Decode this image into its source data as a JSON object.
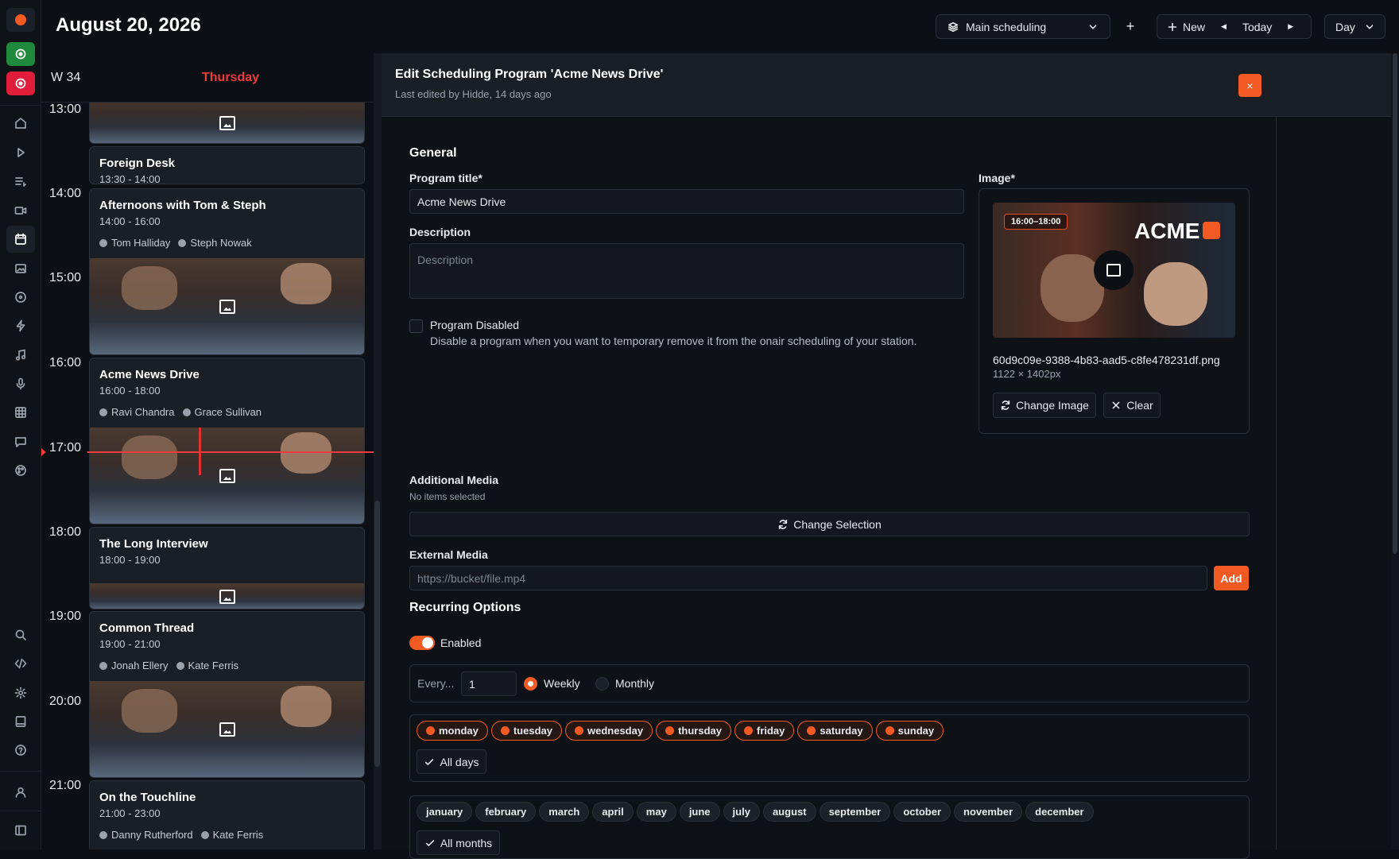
{
  "topbar": {
    "date": "August 20, 2026",
    "schedule_select": "Main scheduling",
    "plus": "+",
    "new_label": "New",
    "today_label": "Today",
    "view_select": "Day"
  },
  "calendar": {
    "week": "W 34",
    "day": "Thursday",
    "hours": [
      "13:00",
      "14:00",
      "15:00",
      "16:00",
      "17:00",
      "18:00",
      "19:00",
      "20:00",
      "21:00"
    ],
    "events": [
      {
        "title": "Foreign Desk",
        "time": "13:30 - 14:00",
        "people": []
      },
      {
        "title": "Afternoons with Tom & Steph",
        "time": "14:00 - 16:00",
        "people": [
          "Tom Halliday",
          "Steph Nowak"
        ]
      },
      {
        "title": "Acme News Drive",
        "time": "16:00 - 18:00",
        "people": [
          "Ravi Chandra",
          "Grace Sullivan"
        ]
      },
      {
        "title": "The Long Interview",
        "time": "18:00 - 19:00",
        "people": []
      },
      {
        "title": "Common Thread",
        "time": "19:00 - 21:00",
        "people": [
          "Jonah Ellery",
          "Kate Ferris"
        ]
      },
      {
        "title": "On the Touchline",
        "time": "21:00 - 23:00",
        "people": [
          "Danny Rutherford",
          "Kate Ferris"
        ]
      }
    ]
  },
  "panel": {
    "title": "Edit Scheduling Program 'Acme News Drive'",
    "subtitle": "Last edited by Hidde, 14 days ago",
    "close": "×",
    "general": "General",
    "program_title_label": "Program title*",
    "program_title_value": "Acme News Drive",
    "description_label": "Description",
    "description_placeholder": "Description",
    "disabled_label": "Program Disabled",
    "disabled_help": "Disable a program when you want to temporary remove it from the onair scheduling of your station.",
    "image_label": "Image*",
    "image_badge": "16:00–18:00",
    "image_brand": "ACME",
    "image_filename": "60d9c09e-9388-4b83-aad5-c8fe478231df.png",
    "image_size": "1122 × 1402px",
    "change_image": "Change Image",
    "clear": "Clear",
    "additional_media_label": "Additional Media",
    "no_items": "No items selected",
    "change_selection": "Change Selection",
    "external_media_label": "External Media",
    "external_media_placeholder": "https://bucket/file.mp4",
    "add": "Add",
    "recurring_label": "Recurring Options",
    "enabled": "Enabled",
    "every": "Every...",
    "every_value": "1",
    "weekly": "Weekly",
    "monthly": "Monthly",
    "days": [
      "monday",
      "tuesday",
      "wednesday",
      "thursday",
      "friday",
      "saturday",
      "sunday"
    ],
    "all_days": "All days",
    "months": [
      "january",
      "february",
      "march",
      "april",
      "may",
      "june",
      "july",
      "august",
      "september",
      "october",
      "november",
      "december"
    ],
    "all_months": "All months"
  },
  "colors": {
    "accent": "#f15a22",
    "now": "#ef3b3b",
    "active_green": "#1f8a3b"
  }
}
